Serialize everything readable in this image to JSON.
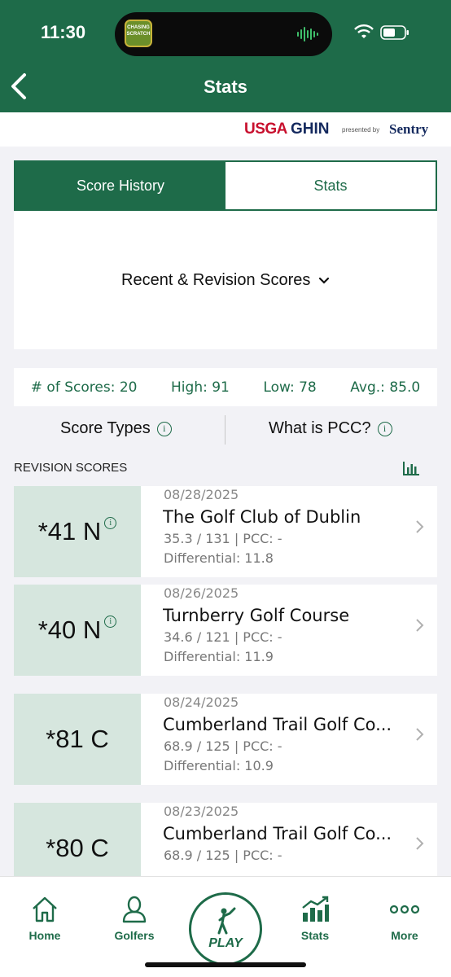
{
  "status": {
    "time": "11:30",
    "app_badge": "CHASING SCRATCH"
  },
  "header": {
    "title": "Stats"
  },
  "brand": {
    "usga": "USGA",
    "ghin": "GHIN",
    "presented": "presented by",
    "sponsor": "Sentry"
  },
  "tabs": [
    {
      "label": "Score History",
      "active": true
    },
    {
      "label": "Stats",
      "active": false
    }
  ],
  "filter": {
    "label": "Recent & Revision Scores"
  },
  "summary": {
    "count": "# of Scores: 20",
    "high": "High: 91",
    "low": "Low: 78",
    "avg": "Avg.: 85.0"
  },
  "links": {
    "score_types": "Score Types",
    "pcc": "What is PCC?",
    "info_glyph": "i"
  },
  "section": {
    "title": "REVISION SCORES"
  },
  "scores": [
    {
      "score": "*41 N",
      "has_info": true,
      "date": "08/28/2025",
      "course": "The Golf Club of Dublin",
      "rating": "35.3 / 131 | PCC: -",
      "differential": "Differential:  11.8"
    },
    {
      "score": "*40 N",
      "has_info": true,
      "date": "08/26/2025",
      "course": "Turnberry Golf Course",
      "rating": "34.6 / 121 | PCC: -",
      "differential": "Differential:  11.9"
    },
    {
      "score": "*81 C",
      "has_info": false,
      "date": "08/24/2025",
      "course": "Cumberland Trail Golf Co...",
      "rating": "68.9 / 125 | PCC: -",
      "differential": "Differential:  10.9"
    },
    {
      "score": "*80 C",
      "has_info": false,
      "date": "08/23/2025",
      "course": "Cumberland Trail Golf Co...",
      "rating": "68.9 / 125 | PCC: -",
      "differential": ""
    }
  ],
  "tabbar": {
    "home": "Home",
    "golfers": "Golfers",
    "play": "PLAY",
    "stats": "Stats",
    "more": "More"
  },
  "colors": {
    "brand_green": "#1e6b49",
    "score_bg": "#d6e6de",
    "usga_red": "#c8102e",
    "ghin_navy": "#14295e"
  }
}
